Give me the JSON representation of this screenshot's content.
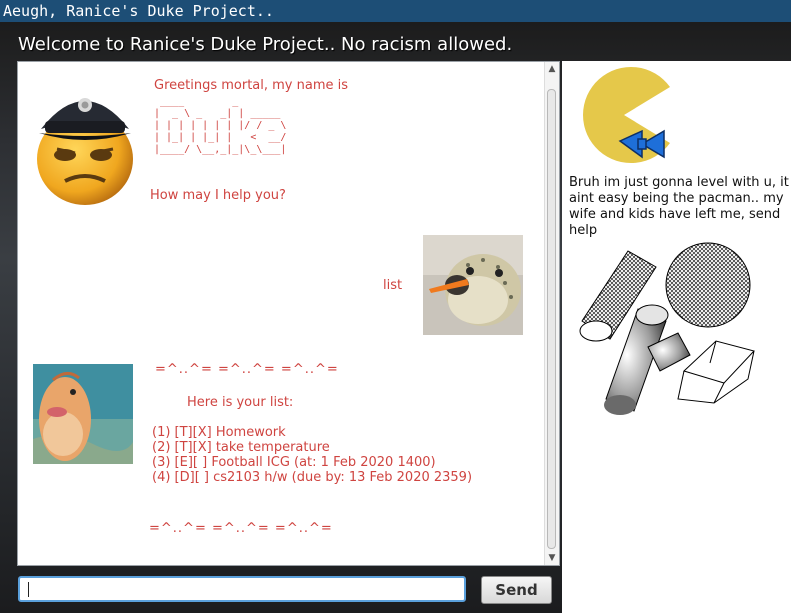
{
  "window": {
    "title": "Aeugh, Ranice's Duke Project.."
  },
  "header": {
    "welcome": "Welcome to Ranice's Duke Project.. No racism allowed."
  },
  "chat": {
    "greeting": "Greetings mortal, my name is",
    "logo_ascii": " ____        _        \n|  _ \\ _   _| | _____ \n| | | | | | | |/ / _ \\\n| |_| | |_| |   <  __/\n|____/ \\__,_|_|\\_\\___|",
    "help_prompt": "How may I help you?",
    "user_message": "list",
    "separator_1": "=^..^=   =^..^=   =^..^=",
    "list_heading": "Here is your list:",
    "list_items": [
      "(1) [T][X]  Homework",
      "(2) [T][X]  take temperature",
      "(3) [E][ ] Football ICG (at: 1 Feb 2020 1400)",
      "(4) [D][ ] cs2103 h/w (due by: 13 Feb 2020 2359)"
    ],
    "separator_2": "=^..^=   =^..^=   =^..^="
  },
  "input": {
    "value": "",
    "placeholder": ""
  },
  "send_button": {
    "label": "Send"
  },
  "sidebar": {
    "message": "Bruh im just gonna level with u, it aint easy being the pacman.. my wife and kids have left me, send help"
  },
  "colors": {
    "titlebar": "#1d4e76",
    "bot_text": "#cf4440",
    "pacman": "#e5c84a",
    "bowtie": "#1e6fd9",
    "input_focus": "#5aa0dc"
  },
  "icons": {
    "duke_avatar": "police-emoji-avatar",
    "user_avatar": "pufferfish-carrot-avatar",
    "fish_avatar": "fish-avatar",
    "pacman": "pacman-bowtie-icon",
    "shapes": "wireframe-shapes-illustration"
  }
}
